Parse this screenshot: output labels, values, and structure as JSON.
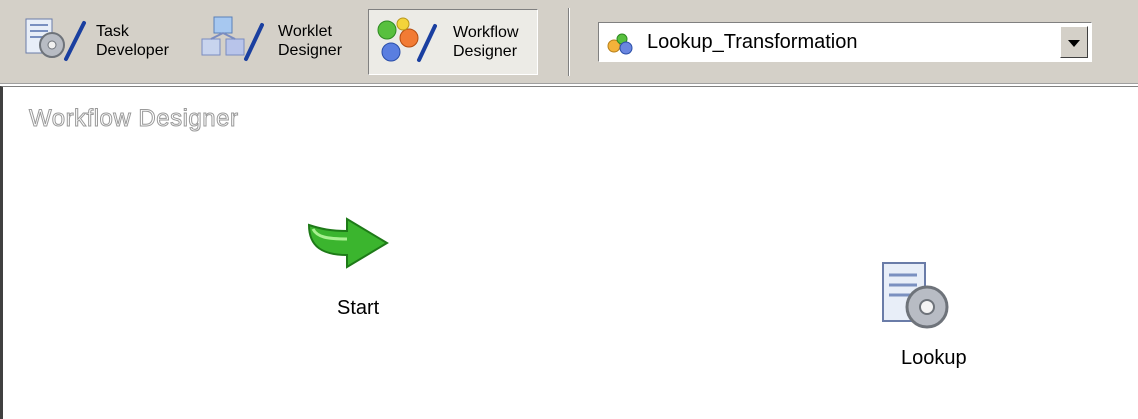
{
  "toolbar": {
    "tools": [
      {
        "line1": "Task",
        "line2": "Developer",
        "icon": "task-developer-icon"
      },
      {
        "line1": "Worklet",
        "line2": "Designer",
        "icon": "worklet-designer-icon"
      },
      {
        "line1": "Workflow",
        "line2": "Designer",
        "icon": "workflow-designer-icon",
        "active": true
      }
    ],
    "workflow_select": {
      "value": "Lookup_Transformation",
      "icon": "workflow-icon"
    }
  },
  "canvas": {
    "title": "Workflow Designer",
    "nodes": [
      {
        "label": "Start",
        "icon": "start-arrow-icon"
      },
      {
        "label": "Lookup",
        "icon": "lookup-task-icon"
      }
    ]
  },
  "colors": {
    "toolbar_bg": "#d4d0c8",
    "start_green": "#3bb52e",
    "active_tool_bg": "#ecebe6"
  }
}
